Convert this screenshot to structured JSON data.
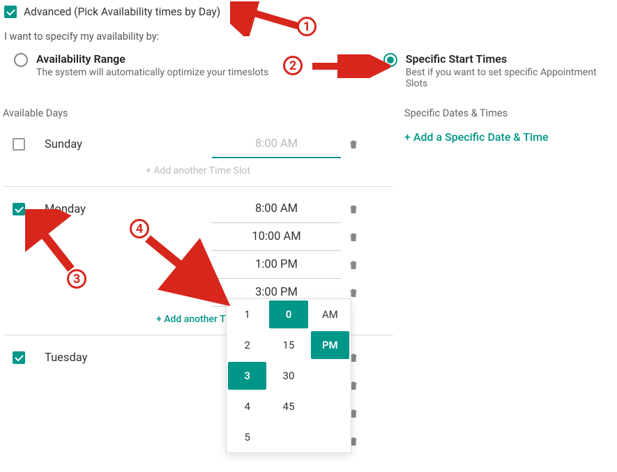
{
  "advanced": {
    "checked": true,
    "label": "Advanced (Pick Availability times by Day)"
  },
  "specify_label": "I want to specify my availability by:",
  "radio": {
    "range": {
      "selected": false,
      "title": "Availability Range",
      "sub": "The system will automatically optimize your timeslots"
    },
    "specific": {
      "selected": true,
      "title": "Specific Start Times",
      "sub": "Best if you want to set specific Appointment Slots"
    }
  },
  "left_header": "Available Days",
  "right_header": "Specific Dates & Times",
  "add_specific": "+ Add a Specific Date & Time",
  "add_slot_label": "+ Add another Time Slot",
  "add_slot_label_trimmed": "+ Add another Tir",
  "days": {
    "sunday": {
      "name": "Sunday",
      "checked": false,
      "slots": [
        "8:00 AM"
      ]
    },
    "monday": {
      "name": "Monday",
      "checked": true,
      "slots": [
        "8:00 AM",
        "10:00 AM",
        "1:00 PM",
        "3:00 PM"
      ]
    },
    "tuesday": {
      "name": "Tuesday",
      "checked": true
    }
  },
  "picker": {
    "hours": [
      "1",
      "2",
      "3",
      "4",
      "5"
    ],
    "minutes": [
      "0",
      "15",
      "30",
      "45"
    ],
    "ampm": [
      "AM",
      "PM"
    ],
    "sel_hour": "3",
    "sel_min": "0",
    "sel_ap": "PM"
  },
  "annotations": {
    "n1": "1",
    "n2": "2",
    "n3": "3",
    "n4": "4"
  }
}
